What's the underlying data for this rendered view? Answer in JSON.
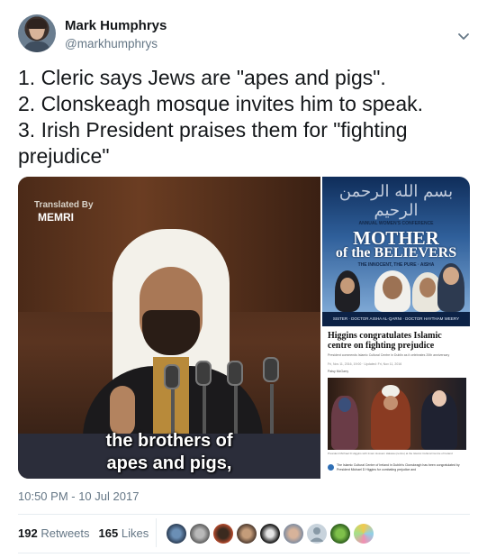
{
  "author": {
    "name": "Mark Humphrys",
    "handle": "@markhumphrys"
  },
  "tweet": {
    "lines": [
      "1. Cleric says Jews are \"apes and pigs\".",
      "2. Clonskeagh mosque invites him to speak.",
      "3. Irish President praises them for \"fighting",
      "prejudice\""
    ]
  },
  "media": {
    "video": {
      "logo_top": "Translated By",
      "logo_bottom": "MEMRI",
      "caption_line1": "the brothers of",
      "caption_line2": "apes and pigs,"
    },
    "poster": {
      "arabic": "بسم الله الرحمن الرحيم",
      "pretitle": "ANNUAL WOMEN'S CONFERENCE",
      "title1": "MOTHER",
      "title2": "of the BELIEVERS",
      "subtitle": "THE INNOCENT, THE PURE · AISHA",
      "footer": "SISTER · DOCTOR AISHA AL-QARNI · DOCTOR HAYTHAM WEERY"
    },
    "article": {
      "title": "Higgins congratulates Islamic centre on fighting prejudice",
      "subtitle": "President commends Islamic Cultural Centre in Dublin as it celebrates 20th anniversary",
      "meta": "Fri, Nov 11, 2016, 19:00 · Updated: Fri, Nov 11, 2016",
      "byline": "Patsy McGarry",
      "photo_caption": "President Michael D Higgins with Imam Hussein Halawa (centre) at the Islamic Cultural Centre of Ireland",
      "footnote": "The Islamic Cultural Centre of Ireland in Dublin's Clonskeagh has been congratulated by President Michael D Higgins for combating prejudice and"
    }
  },
  "timestamp": "10:50 PM - 10 Jul 2017",
  "stats": {
    "retweets_count": "192",
    "retweets_label": "Retweets",
    "likes_count": "165",
    "likes_label": "Likes"
  },
  "colors": {
    "text": "#14171a",
    "secondary": "#657786",
    "divider": "#e6ecf0"
  },
  "icons": {
    "menu": "chevron-down-icon"
  }
}
